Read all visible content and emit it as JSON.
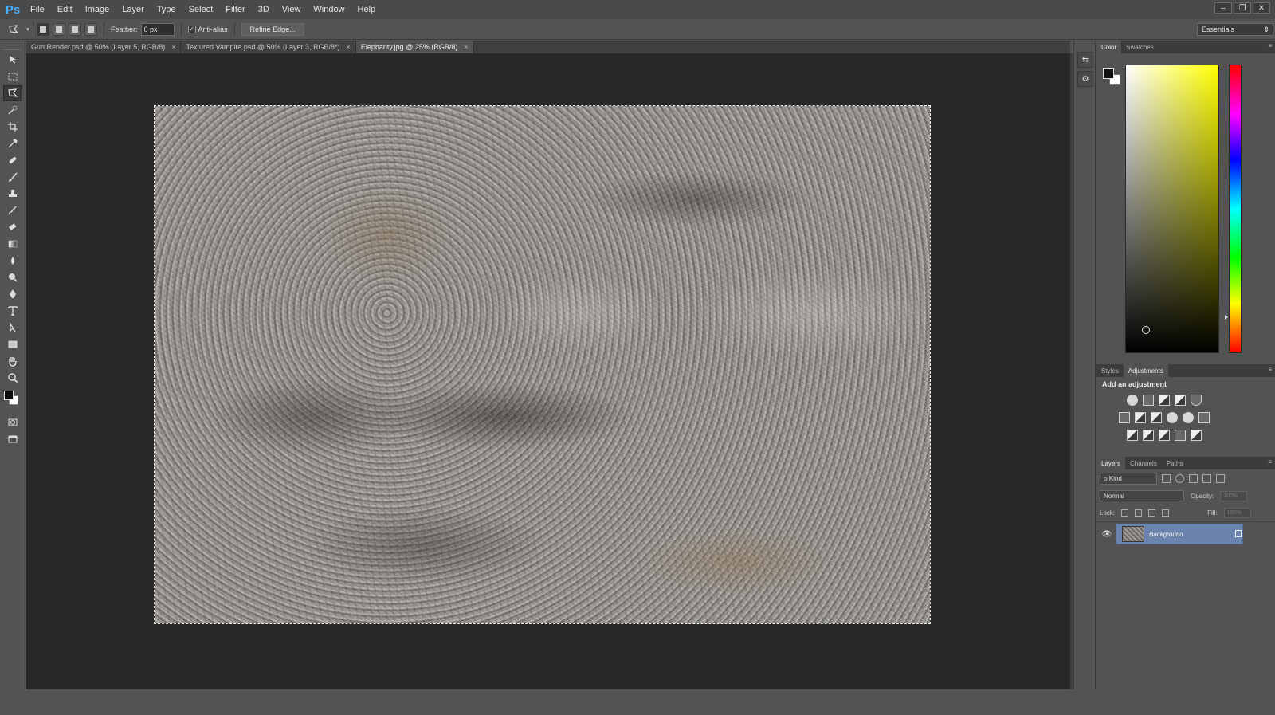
{
  "app": {
    "logo": "Ps"
  },
  "menu": [
    "File",
    "Edit",
    "Image",
    "Layer",
    "Type",
    "Select",
    "Filter",
    "3D",
    "View",
    "Window",
    "Help"
  ],
  "window_buttons": [
    "–",
    "❐",
    "✕"
  ],
  "options": {
    "feather_label": "Feather:",
    "feather_value": "0 px",
    "antialias_label": "Anti-alias",
    "refine_label": "Refine Edge...",
    "workspace": "Essentials"
  },
  "tabs": [
    {
      "label": "Gun Render.psd @ 50% (Layer 5, RGB/8)",
      "close": "×"
    },
    {
      "label": "Textured Vampire.psd @ 50% (Layer 3, RGB/8*)",
      "close": "×"
    },
    {
      "label": "Elephanty.jpg @ 25% (RGB/8)",
      "close": "×"
    }
  ],
  "panels": {
    "color_tabs": [
      "Color",
      "Swatches"
    ],
    "adjust_tabs": [
      "Styles",
      "Adjustments"
    ],
    "adjust_title": "Add an adjustment",
    "layers_tabs": [
      "Layers",
      "Channels",
      "Paths"
    ],
    "kind_label": "ρ Kind",
    "blend_mode": "Normal",
    "opacity_label": "Opacity:",
    "opacity_value": "100%",
    "lock_label": "Lock:",
    "fill_label": "Fill:",
    "fill_value": "100%",
    "layer_name": "Background",
    "menu_glyph": "≡"
  },
  "colors": {
    "foreground": "#0a0a0a",
    "background": "#ffffff",
    "selected_layer": "#6a84ad"
  },
  "icons": [
    "polygonal-lasso-icon",
    "move-icon",
    "marquee-icon",
    "quick-select-icon",
    "crop-icon",
    "eyedropper-icon",
    "healing-icon",
    "brush-icon",
    "stamp-icon",
    "history-brush-icon",
    "eraser-icon",
    "gradient-icon",
    "blur-icon",
    "dodge-icon",
    "pen-icon",
    "type-icon",
    "path-select-icon",
    "rectangle-icon",
    "hand-icon",
    "zoom-icon",
    "eye-icon",
    "lock-icon"
  ]
}
